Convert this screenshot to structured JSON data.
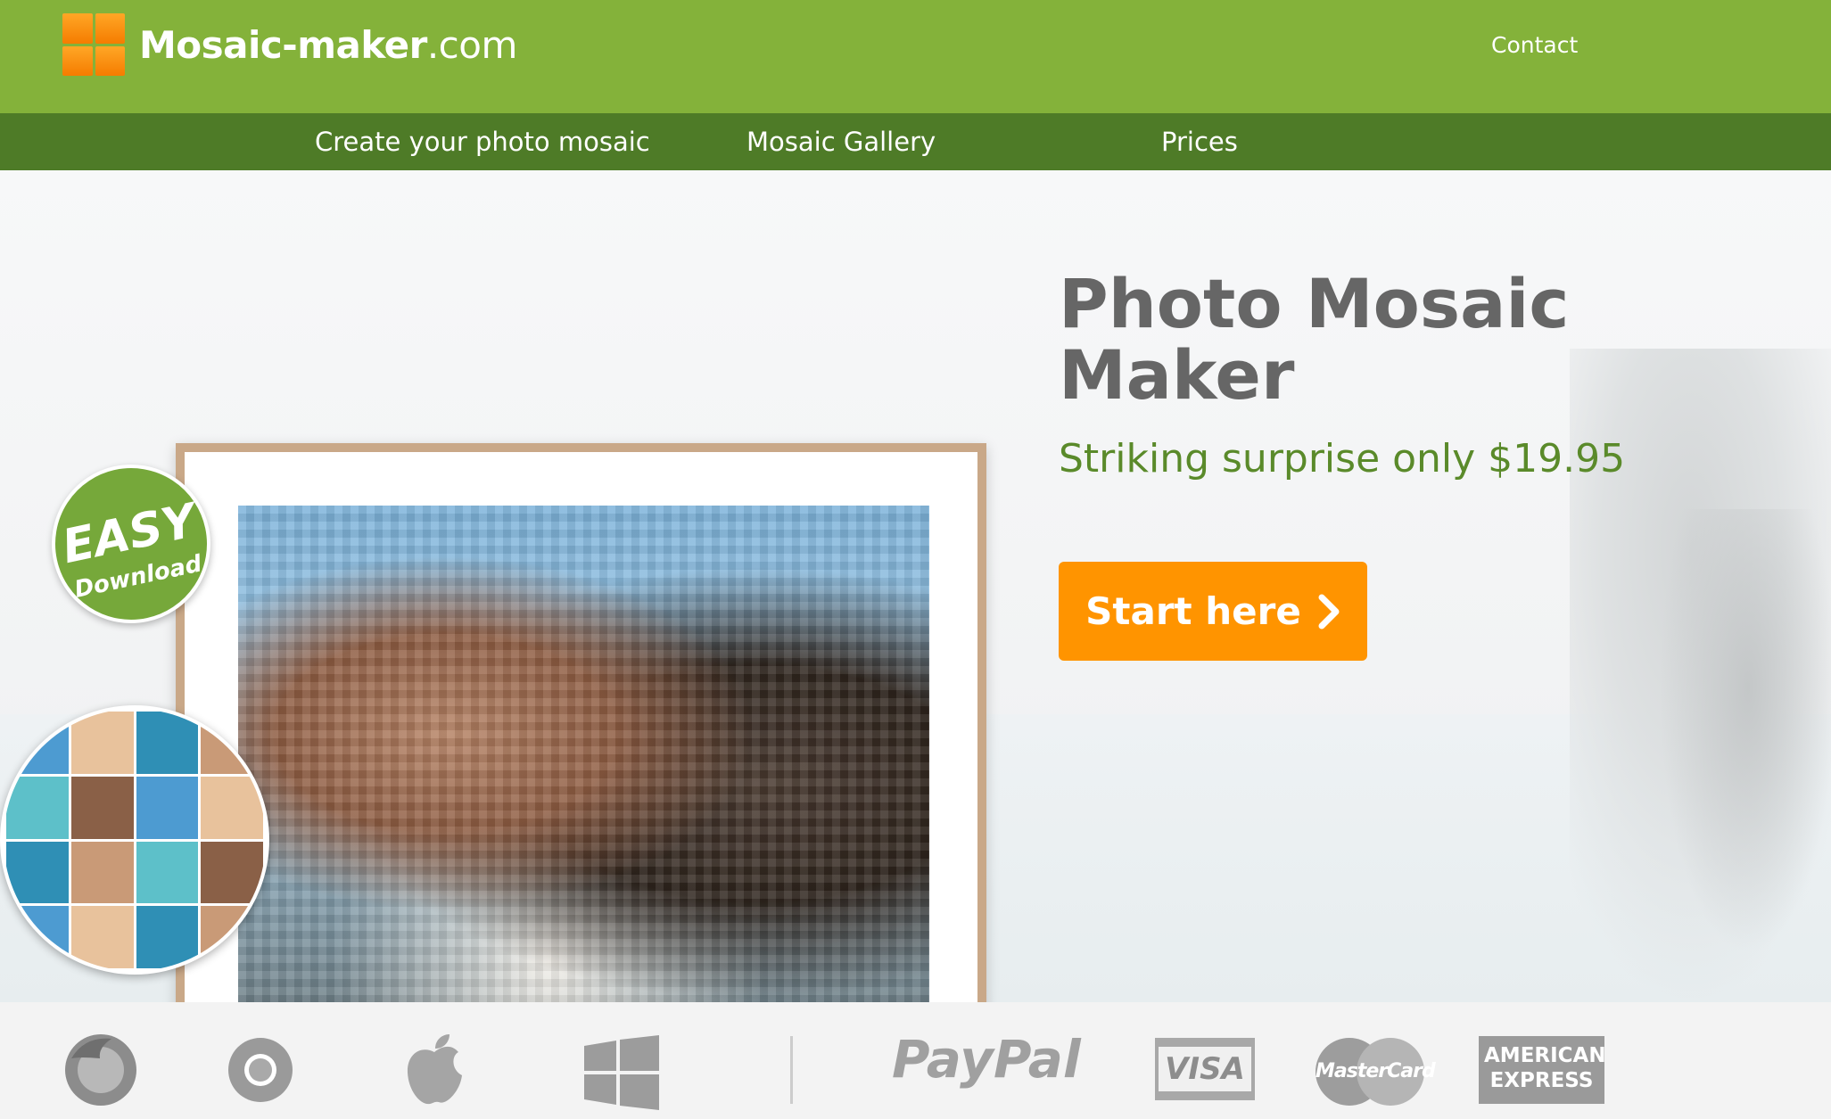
{
  "header": {
    "logo_text_bold": "Mosaic-maker",
    "logo_text_suffix": ".com",
    "contact": "Contact"
  },
  "nav": {
    "items": [
      {
        "label": "Create your photo mosaic"
      },
      {
        "label": "Mosaic Gallery"
      },
      {
        "label": "Prices"
      }
    ]
  },
  "hero": {
    "badge_line1": "EASY",
    "badge_line2": "Download",
    "title": "Photo Mosaic Maker",
    "subtitle": "Striking surprise only $19.95",
    "cta_label": "Start here"
  },
  "footer": {
    "platform_icons": [
      "firefox-icon",
      "chrome-icon",
      "apple-icon",
      "windows-icon"
    ],
    "payment_paypal": "PayPal",
    "payment_visa": "VISA",
    "payment_mastercard": "MasterCard",
    "payment_amex": "AMERICAN EXPRESS"
  },
  "colors": {
    "header_green": "#84b23a",
    "nav_green": "#4e7b27",
    "cta_orange": "#ff9400",
    "subtitle_green": "#5a8a2a",
    "title_gray": "#666666"
  }
}
